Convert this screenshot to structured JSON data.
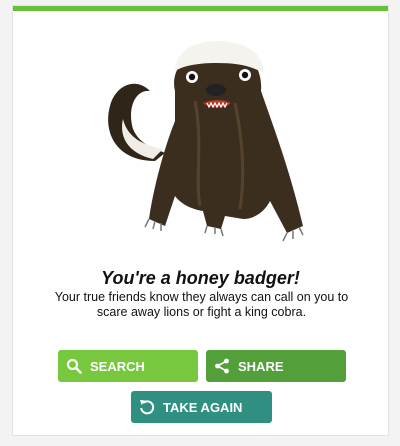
{
  "result": {
    "title": "You're a honey badger!",
    "description": "Your true friends know they always can call on you to scare away lions or fight a king cobra."
  },
  "buttons": {
    "search": {
      "label": "SEARCH",
      "icon": "search-icon",
      "color": "#78c83f"
    },
    "share": {
      "label": "SHARE",
      "icon": "share-icon",
      "color": "#53a03a"
    },
    "take_again": {
      "label": "TAKE AGAIN",
      "icon": "restart-icon",
      "color": "#2f8f80"
    }
  },
  "colors": {
    "accent_bar": "#67c23a"
  }
}
